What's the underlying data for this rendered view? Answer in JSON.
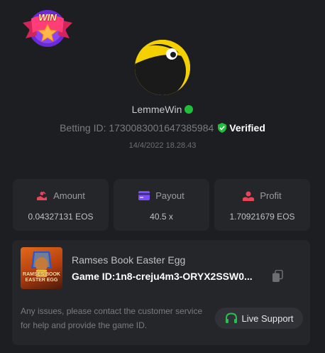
{
  "badge": {
    "text": "WIN"
  },
  "user": {
    "name": "LemmeWin",
    "status_color": "#1fbf3a"
  },
  "bet": {
    "id_label": "Betting ID: 1730083001647385984",
    "verified_label": "Verified",
    "timestamp": "14/4/2022 18.28.43"
  },
  "stats": [
    {
      "icon": "amount-icon",
      "label": "Amount",
      "value": "0.04327131 EOS"
    },
    {
      "icon": "payout-icon",
      "label": "Payout",
      "value": "40.5 x"
    },
    {
      "icon": "profit-icon",
      "label": "Profit",
      "value": "1.70921679 EOS"
    }
  ],
  "game": {
    "name": "Ramses Book Easter Egg",
    "thumb_text_line1": "RAMSES BOOK",
    "thumb_text_line2": "EASTER EGG",
    "id_label": "Game ID:1n8-creju4m3-ORYX2SSW0..."
  },
  "support": {
    "help_text": "Any issues, please contact the customer service for help and provide the game ID.",
    "button_label": "Live Support"
  },
  "colors": {
    "background": "#1d1e21",
    "card": "#25262a",
    "accent_red": "#e8445a",
    "accent_purple": "#7b4dff",
    "verified_green": "#1fbf3a",
    "support_green": "#27c24c"
  }
}
